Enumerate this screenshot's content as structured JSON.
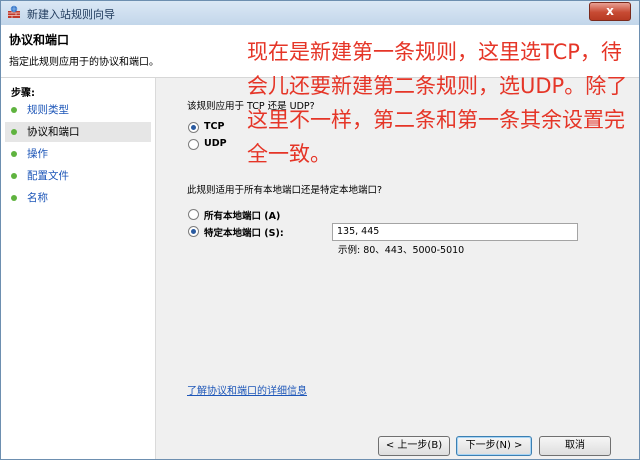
{
  "window": {
    "title": "新建入站规则向导",
    "close_label": "x"
  },
  "header": {
    "title": "协议和端口",
    "description": "指定此规则应用于的协议和端口。"
  },
  "annotation": {
    "text": "现在是新建第一条规则，这里选TCP，待会儿还要新建第二条规则，选UDP。除了这里不一样，第二条和第一条其余设置完全一致。"
  },
  "sidebar": {
    "steps_label": "步骤:",
    "items": [
      {
        "label": "规则类型"
      },
      {
        "label": "协议和端口"
      },
      {
        "label": "操作"
      },
      {
        "label": "配置文件"
      },
      {
        "label": "名称"
      }
    ]
  },
  "content": {
    "protocol_question": "该规则应用于 TCP 还是 UDP?",
    "protocol_options": [
      {
        "label": "TCP",
        "selected": true
      },
      {
        "label": "UDP",
        "selected": false
      }
    ],
    "port_question": "此规则适用于所有本地端口还是特定本地端口?",
    "port_options": [
      {
        "label": "所有本地端口 (A)",
        "selected": false
      },
      {
        "label": "特定本地端口 (S):",
        "selected": true
      }
    ],
    "port_value": "135, 445",
    "example": "示例: 80、443、5000-5010",
    "help_link": "了解协议和端口的详细信息"
  },
  "buttons": {
    "back": "< 上一步(B)",
    "next": "下一步(N) >",
    "cancel": "取消"
  },
  "colors": {
    "annotation": "#e53527",
    "link": "#1d56b8",
    "step_bullet": "#5fb33f"
  }
}
